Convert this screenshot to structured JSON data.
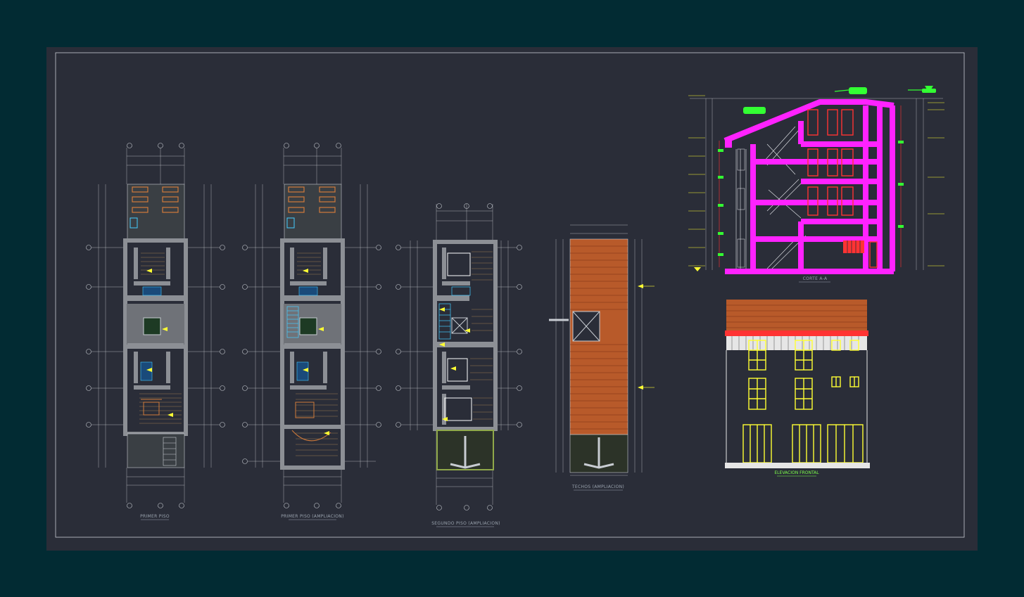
{
  "drawing": {
    "plan_titles": {
      "first_floor": "PRIMER PISO",
      "first_floor_ext": "PRIMER PISO (AMPLIACION)",
      "second_floor_ext": "SEGUNDO PISO (AMPLIACION)",
      "roof_ext": "TECHOS (AMPLIACION)"
    },
    "section_title": "CORTE A-A",
    "elevation_title": "ELEVACION FRONTAL"
  },
  "colors": {
    "canvas": "#022b33",
    "sheet": "#2a2d38",
    "wall": "#8c8f95",
    "magenta": "#ff22ff",
    "yellow": "#ffff33",
    "green": "#33ff33",
    "red": "#ff3333",
    "roof": "#b85a2a",
    "cyan": "#44ccff"
  },
  "icons": {
    "north_arrow": "north-arrow-icon",
    "level_marker": "level-marker-icon"
  }
}
